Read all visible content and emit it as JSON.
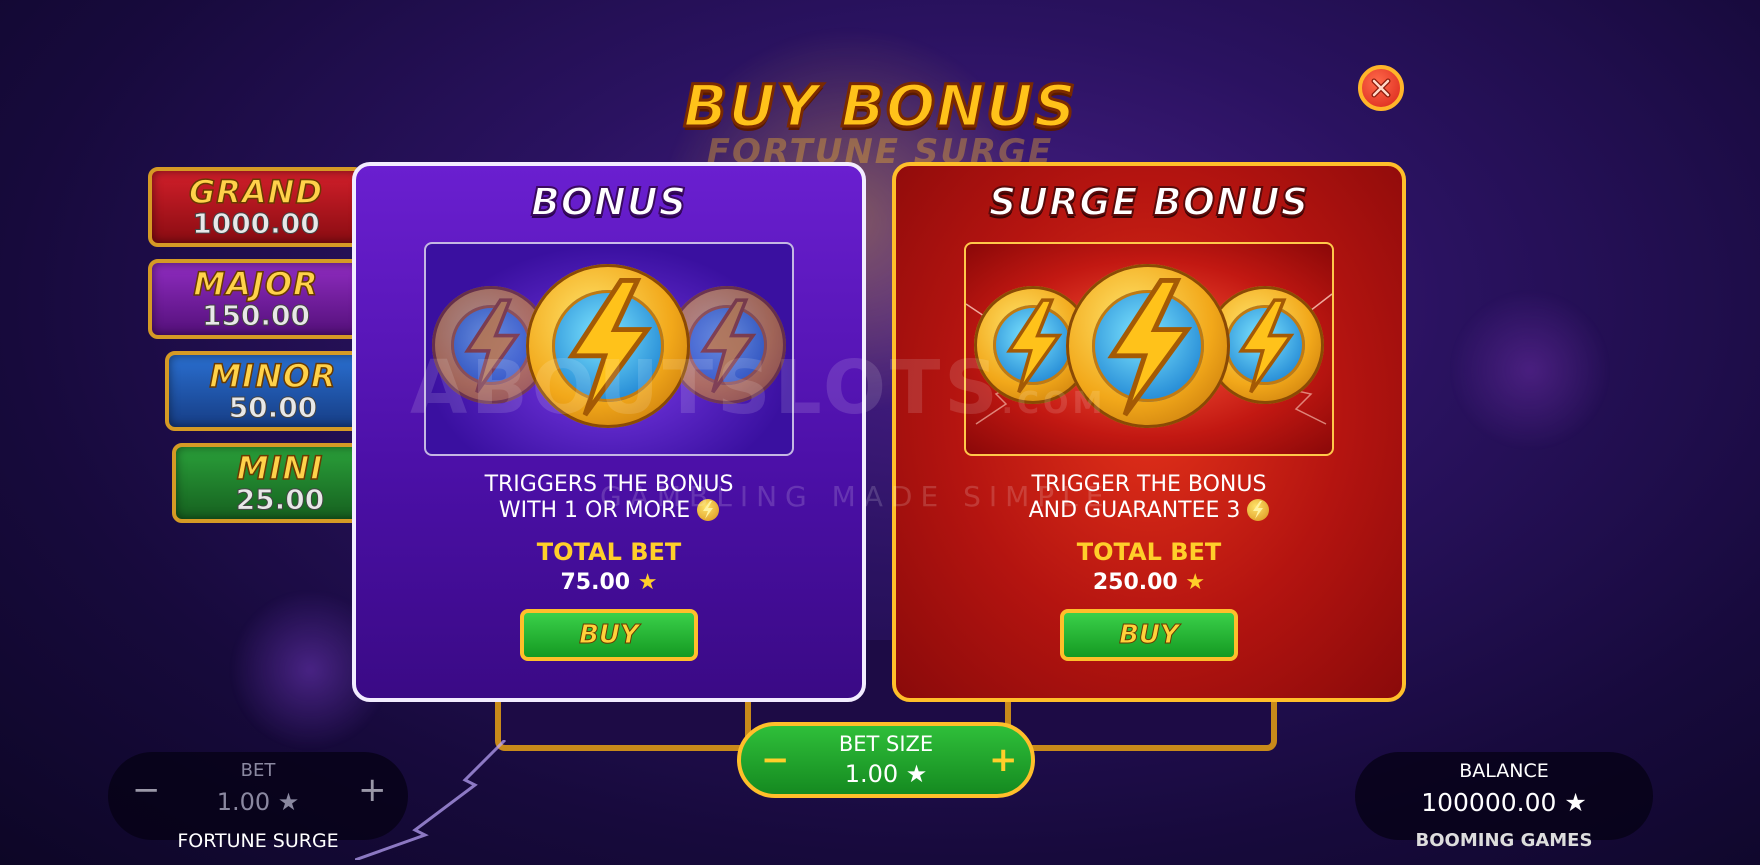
{
  "title": "BUY BONUS",
  "game_logo_ghost": "FORTUNE SURGE",
  "jackpots": [
    {
      "name": "GRAND",
      "value": "1000.00"
    },
    {
      "name": "MAJOR",
      "value": "150.00"
    },
    {
      "name": "MINOR",
      "value": "50.00"
    },
    {
      "name": "MINI",
      "value": "25.00"
    }
  ],
  "panels": {
    "bonus": {
      "title": "BONUS",
      "description_line1": "TRIGGERS THE BONUS",
      "description_line2": "WITH 1 OR MORE",
      "total_bet_label": "TOTAL BET",
      "total_bet_value": "75.00",
      "buy_label": "BUY"
    },
    "surge": {
      "title": "SURGE BONUS",
      "description_line1": "TRIGGER THE BONUS",
      "description_line2": "AND GUARANTEE 3",
      "total_bet_label": "TOTAL BET",
      "total_bet_value": "250.00",
      "buy_label": "BUY"
    }
  },
  "star_glyph": "★",
  "bet": {
    "label": "BET",
    "value": "1.00",
    "minus": "−",
    "plus": "+"
  },
  "game_name": "FORTUNE SURGE",
  "bet_size": {
    "label": "BET SIZE",
    "value": "1.00",
    "minus": "−",
    "plus": "+"
  },
  "balance": {
    "label": "BALANCE",
    "value": "100000.00"
  },
  "brand": "BOOMING GAMES",
  "watermark": {
    "main": "ABOUTSLOTS",
    "suffix": ".COM",
    "tagline": "GAMBLING MADE SIMPLE"
  },
  "colors": {
    "bonus_panel": "#5a18c0",
    "surge_panel": "#c41a12",
    "gold": "#ffc21a",
    "buy_green": "#2ab83a"
  },
  "icons": [
    "close-icon",
    "lightning-coin-icon",
    "star-icon",
    "minus-icon",
    "plus-icon"
  ]
}
